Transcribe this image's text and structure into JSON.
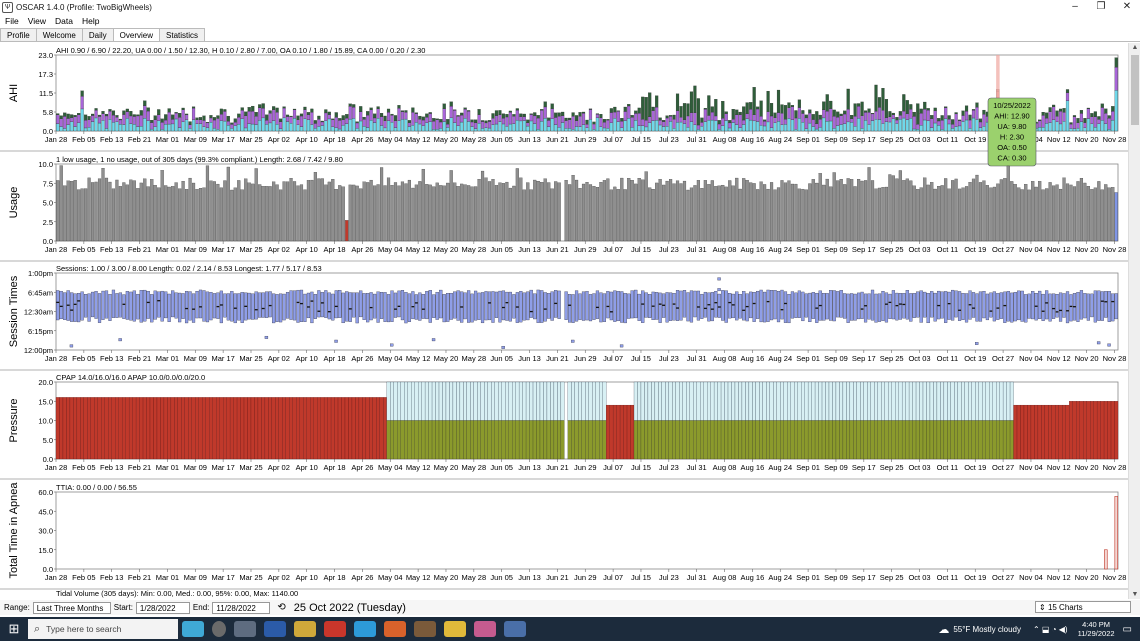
{
  "window": {
    "title": "OSCAR 1.4.0 (Profile: TwoBigWheels)",
    "icon_label": "Ѱ",
    "controls": [
      "–",
      "❐",
      "✕"
    ]
  },
  "menu": [
    "File",
    "View",
    "Data",
    "Help"
  ],
  "tabs": [
    {
      "label": "Profile",
      "active": false
    },
    {
      "label": "Welcome",
      "active": false
    },
    {
      "label": "Daily",
      "active": false
    },
    {
      "label": "Overview",
      "active": true
    },
    {
      "label": "Statistics",
      "active": false
    }
  ],
  "x_ticks": [
    "Jan 28",
    "Feb 05",
    "Feb 13",
    "Feb 21",
    "Mar 01",
    "Mar 09",
    "Mar 17",
    "Mar 25",
    "Apr 02",
    "Apr 10",
    "Apr 18",
    "Apr 26",
    "May 04",
    "May 12",
    "May 20",
    "May 28",
    "Jun 05",
    "Jun 13",
    "Jun 21",
    "Jun 29",
    "Jul 07",
    "Jul 15",
    "Jul 23",
    "Jul 31",
    "Aug 08",
    "Aug 16",
    "Aug 24",
    "Sep 01",
    "Sep 09",
    "Sep 17",
    "Sep 25",
    "Oct 03",
    "Oct 11",
    "Oct 19",
    "Oct 27",
    "Nov 04",
    "Nov 12",
    "Nov 20",
    "Nov 28"
  ],
  "colors": {
    "ahi_ua": "#6fd8ea",
    "ahi_h": "#a865d8",
    "ahi_oa": "#2f5e3a",
    "ahi_highlight": "#f0a7a0",
    "usage": "#8f8f8f",
    "usage_low": "#c0392b",
    "usage_recent": "#7f95e6",
    "session": "#8f9ee8",
    "pressure_cpap": "#c0392b",
    "pressure_apap_min": "#8b9a2c",
    "pressure_apap_max": "#d8f0f4",
    "tooltip": "#9bd16d"
  },
  "chart_data": [
    {
      "type": "bar",
      "chart_id": "ahi",
      "ylabel": "AHI",
      "summary": "AHI 0.90 / 6.90 / 22.20, UA 0.00 / 1.50 / 12.30, H 0.10 / 2.80 / 7.00, OA 0.10 / 1.80 / 15.89, CA 0.00 / 0.20 / 2.30",
      "ylim": [
        0,
        23.0
      ],
      "y_ticks": [
        "23.0",
        "17.3",
        "11.5",
        "5.8",
        "0.0"
      ],
      "x_range": [
        "2022-01-28",
        "2022-11-28"
      ],
      "stacked": true,
      "series_order": [
        "UA",
        "H",
        "OA"
      ],
      "typical_values": {
        "UA": 1.5,
        "H": 2.8,
        "OA": 1.8
      },
      "highlight": {
        "date": "2022-10-25",
        "AHI": 12.9,
        "UA": 9.8,
        "H": 2.3,
        "OA": 0.5,
        "CA": 0.3
      },
      "tooltip_lines": [
        "10/25/2022",
        "AHI: 12.90",
        "UA: 9.80",
        "H: 2.30",
        "OA: 0.50",
        "CA: 0.30"
      ]
    },
    {
      "type": "bar",
      "chart_id": "usage",
      "ylabel": "Usage",
      "summary": "1 low usage, 1 no usage, out of 305 days (99.3% compliant.) Length: 2.68 / 7.42 / 9.80",
      "ylim": [
        0,
        10.0
      ],
      "y_ticks": [
        "10.0",
        "7.5",
        "5.0",
        "2.5",
        "0.0"
      ],
      "median": 7.42,
      "min": 2.68,
      "max": 9.8,
      "low_usage_date": "2022-04-21",
      "no_usage_date": "2022-06-22"
    },
    {
      "type": "bar",
      "chart_id": "session_times",
      "ylabel": "Session Times",
      "summary": "Sessions: 1.00 / 3.00 / 8.00 Length: 0.02 / 2.14 / 8.53 Longest: 1.77 / 5.17 / 8.53",
      "y_ticks": [
        "1:00pm",
        "6:45am",
        "12:30am",
        "6:15pm",
        "12:00pm"
      ],
      "typical_start": "12:30am",
      "typical_end": "7:30am"
    },
    {
      "type": "bar",
      "chart_id": "pressure",
      "ylabel": "Pressure",
      "summary": "CPAP 14.0/16.0/16.0 APAP 10.0/0.0/0.0/20.0",
      "ylim": [
        0,
        20.0
      ],
      "y_ticks": [
        "20.0",
        "15.0",
        "10.0",
        "5.0",
        "0.0"
      ],
      "segments": [
        {
          "from": "2022-01-28",
          "to": "2022-05-02",
          "mode": "CPAP",
          "value": 16.0
        },
        {
          "from": "2022-05-03",
          "to": "2022-06-22",
          "mode": "APAP",
          "min": 10.0,
          "max": 20.0
        },
        {
          "from": "2022-06-24",
          "to": "2022-07-04",
          "mode": "APAP",
          "min": 10.0,
          "max": 20.0
        },
        {
          "from": "2022-07-05",
          "to": "2022-07-12",
          "mode": "CPAP",
          "value": 14.0
        },
        {
          "from": "2022-07-13",
          "to": "2022-10-29",
          "mode": "APAP",
          "min": 10.0,
          "max": 20.0
        },
        {
          "from": "2022-10-30",
          "to": "2022-11-14",
          "mode": "CPAP",
          "value": 14.0
        },
        {
          "from": "2022-11-15",
          "to": "2022-11-28",
          "mode": "CPAP",
          "value": 15.0
        }
      ]
    },
    {
      "type": "bar",
      "chart_id": "ttia",
      "ylabel": "Total Time in Apnea",
      "summary": "TTIA: 0.00 / 0.00 / 56.55",
      "ylim": [
        0,
        60.0
      ],
      "y_ticks": [
        "60.0",
        "45.0",
        "30.0",
        "15.0",
        "0.0"
      ],
      "points": [
        {
          "date": "2022-11-25",
          "value": 15.0
        },
        {
          "date": "2022-11-28",
          "value": 56.55
        }
      ]
    }
  ],
  "tidal_volume_label": "Tidal Volume (305 days):  Min: 0.00, Med.: 0.00, 95%: 0.00, Max: 1140.00",
  "bottom": {
    "range_label": "Range:",
    "range_value": "Last Three Months",
    "start_label": "Start:",
    "start_value": "1/28/2022",
    "end_label": "End:",
    "end_value": "11/28/2022",
    "date_display": "25 Oct 2022 (Tuesday)",
    "charts_combo": "15 Charts"
  },
  "taskbar": {
    "search_placeholder": "Type here to search",
    "weather": "55°F  Mostly cloudy",
    "time": "4:40 PM",
    "date": "11/29/2022"
  }
}
